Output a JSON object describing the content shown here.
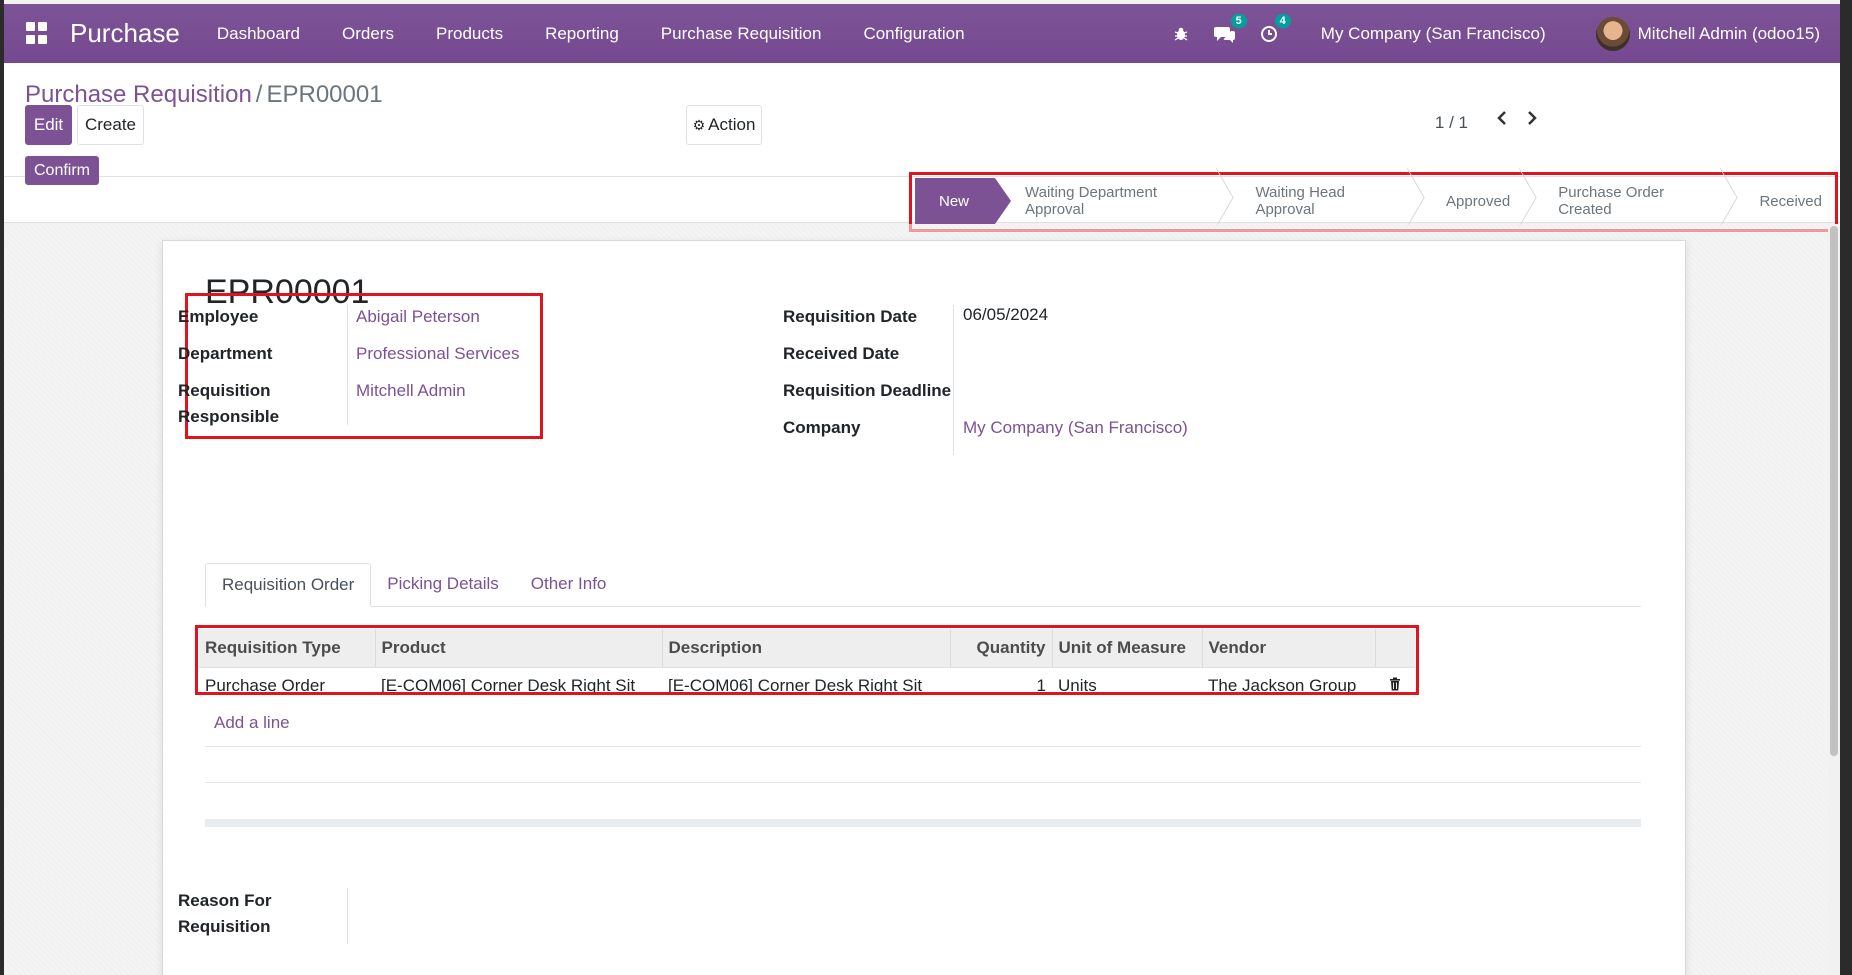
{
  "navbar": {
    "brand": "Purchase",
    "menu": [
      "Dashboard",
      "Orders",
      "Products",
      "Reporting",
      "Purchase Requisition",
      "Configuration"
    ],
    "messages_count": "5",
    "activities_count": "4",
    "company": "My Company (San Francisco)",
    "user": "Mitchell Admin (odoo15)"
  },
  "breadcrumb": {
    "parent": "Purchase Requisition",
    "separator": "/",
    "current": "EPR00001"
  },
  "toolbar": {
    "edit": "Edit",
    "create": "Create",
    "action": "Action",
    "pager": "1 / 1"
  },
  "statusbar": {
    "confirm": "Confirm",
    "steps": [
      "New",
      "Waiting Department Approval",
      "Waiting Head Approval",
      "Approved",
      "Purchase Order Created",
      "Received"
    ]
  },
  "record": {
    "name": "EPR00001",
    "labels": {
      "employee": "Employee",
      "department": "Department",
      "responsible": "Requisition Responsible",
      "req_date": "Requisition Date",
      "received_date": "Received Date",
      "deadline": "Requisition Deadline",
      "company": "Company",
      "reason": "Reason For Requisition"
    },
    "employee": "Abigail Peterson",
    "department": "Professional Services",
    "responsible": "Mitchell Admin",
    "req_date": "06/05/2024",
    "received_date": "",
    "deadline": "",
    "company": "My Company (San Francisco)"
  },
  "tabs": [
    "Requisition Order",
    "Picking Details",
    "Other Info"
  ],
  "lines": {
    "headers": [
      "Requisition Type",
      "Product",
      "Description",
      "Quantity",
      "Unit of Measure",
      "Vendor"
    ],
    "rows": [
      [
        "Purchase Order",
        "[E-COM06] Corner Desk Right Sit",
        "[E-COM06] Corner Desk Right Sit",
        "1",
        "Units",
        "The Jackson Group"
      ]
    ],
    "add_line": "Add a line"
  },
  "colors": {
    "brand": "#7c5295",
    "highlight": "#e0141e",
    "badge": "#00a09d"
  }
}
